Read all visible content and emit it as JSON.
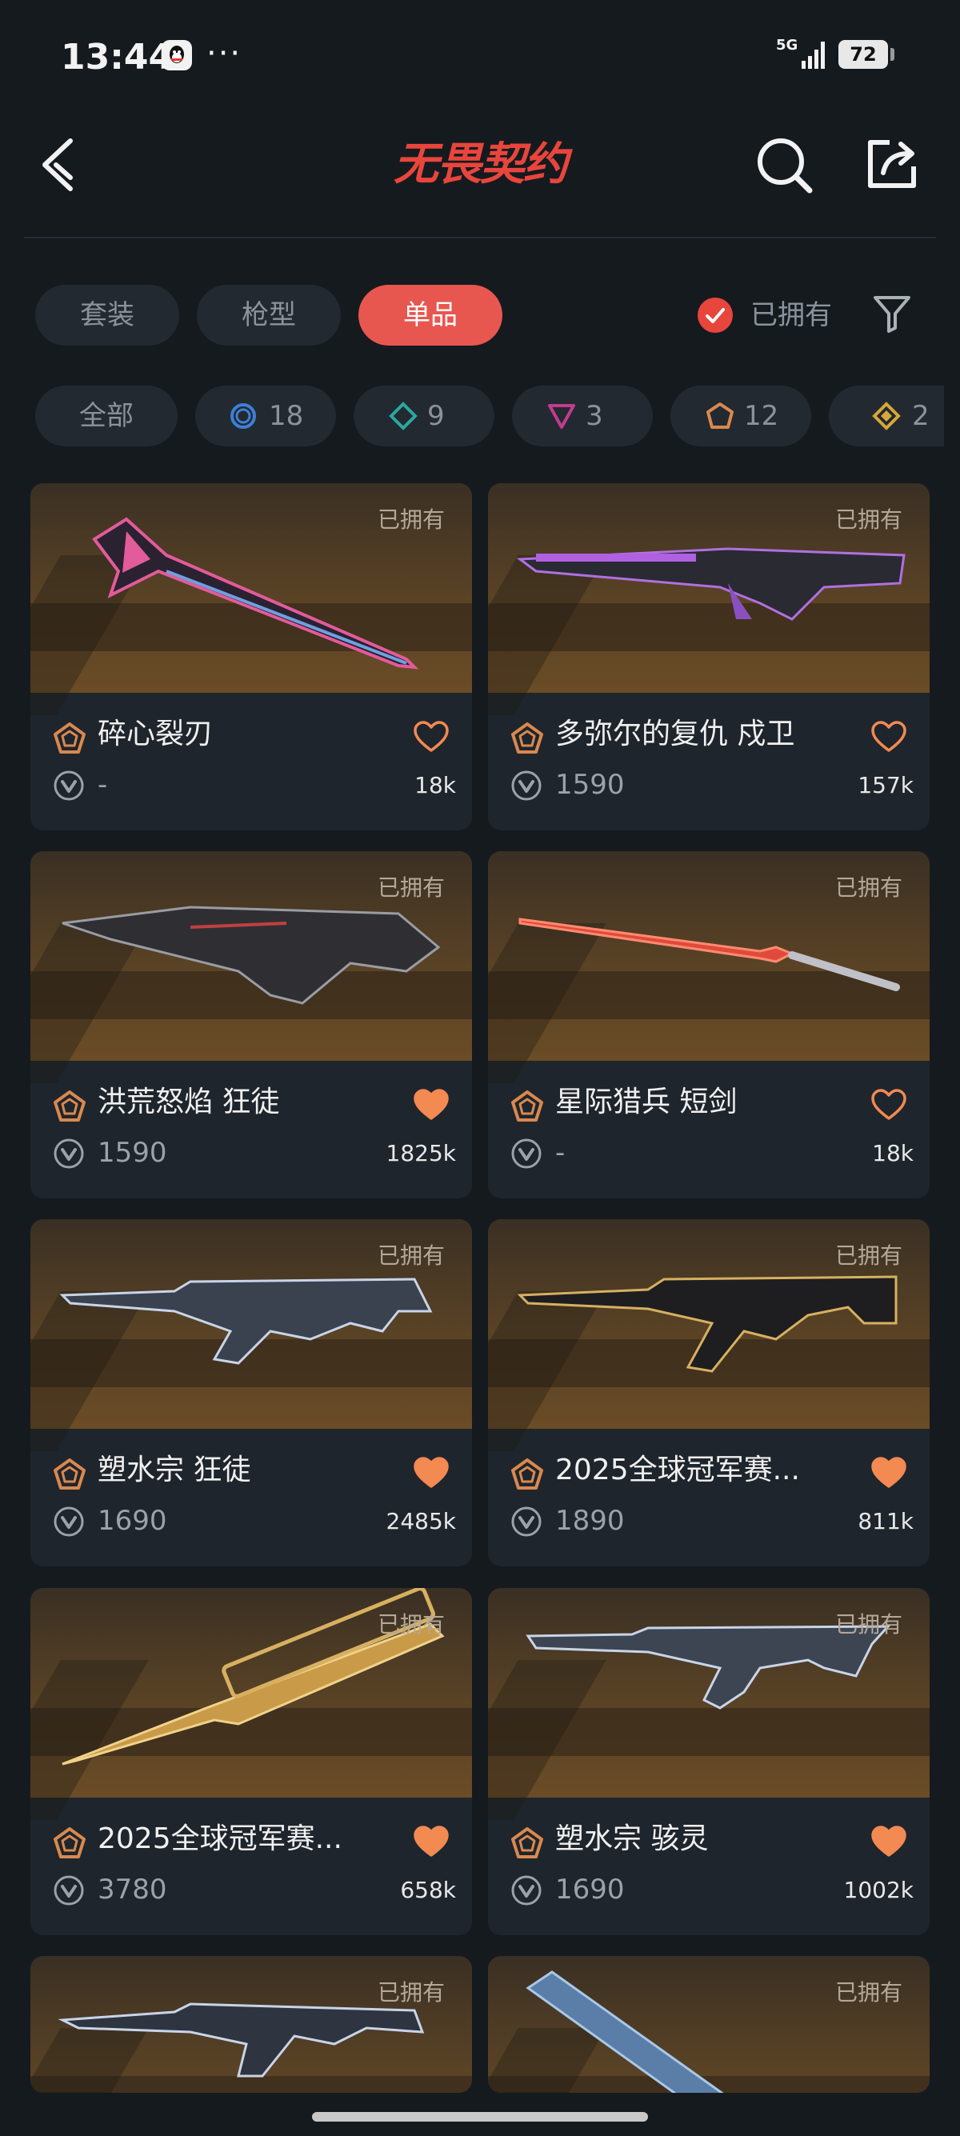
{
  "status": {
    "time": "13:44",
    "network": "5G",
    "battery": "72",
    "more": "···"
  },
  "header": {
    "title": "无畏契约"
  },
  "type_tabs": [
    {
      "label": "套装",
      "active": false
    },
    {
      "label": "枪型",
      "active": false
    },
    {
      "label": "单品",
      "active": true
    }
  ],
  "owned_filter": {
    "label": "已拥有",
    "checked": true
  },
  "rarity_filters": [
    {
      "label": "全部",
      "count": ""
    },
    {
      "icon": "select-tier-icon",
      "color": "#3d7fd6",
      "count": "18"
    },
    {
      "icon": "deluxe-tier-icon",
      "color": "#2aa7a0",
      "count": "9"
    },
    {
      "icon": "premium-tier-icon",
      "color": "#c23b8e",
      "count": "3"
    },
    {
      "icon": "ultra-tier-icon",
      "color": "#d9894f",
      "count": "12"
    },
    {
      "icon": "exclusive-tier-icon",
      "color": "#d7a53b",
      "count": "2"
    }
  ],
  "cards": [
    {
      "name": "碎心裂刃",
      "price": "-",
      "likes": "18k",
      "owned_tag": "已拥有",
      "favorited": false
    },
    {
      "name": "多弥尔的复仇 戍卫",
      "price": "1590",
      "likes": "157k",
      "owned_tag": "已拥有",
      "favorited": false
    },
    {
      "name": "洪荒怒焰 狂徒",
      "price": "1590",
      "likes": "1825k",
      "owned_tag": "已拥有",
      "favorited": true
    },
    {
      "name": "星际猎兵 短剑",
      "price": "-",
      "likes": "18k",
      "owned_tag": "已拥有",
      "favorited": false
    },
    {
      "name": "塑水宗 狂徒",
      "price": "1690",
      "likes": "2485k",
      "owned_tag": "已拥有",
      "favorited": true
    },
    {
      "name": "2025全球冠军赛...",
      "price": "1890",
      "likes": "811k",
      "owned_tag": "已拥有",
      "favorited": true
    },
    {
      "name": "2025全球冠军赛...",
      "price": "3780",
      "likes": "658k",
      "owned_tag": "已拥有",
      "favorited": true
    },
    {
      "name": "塑水宗 骇灵",
      "price": "1690",
      "likes": "1002k",
      "owned_tag": "已拥有",
      "favorited": true
    },
    {
      "owned_tag": "已拥有"
    },
    {
      "owned_tag": "已拥有"
    }
  ]
}
